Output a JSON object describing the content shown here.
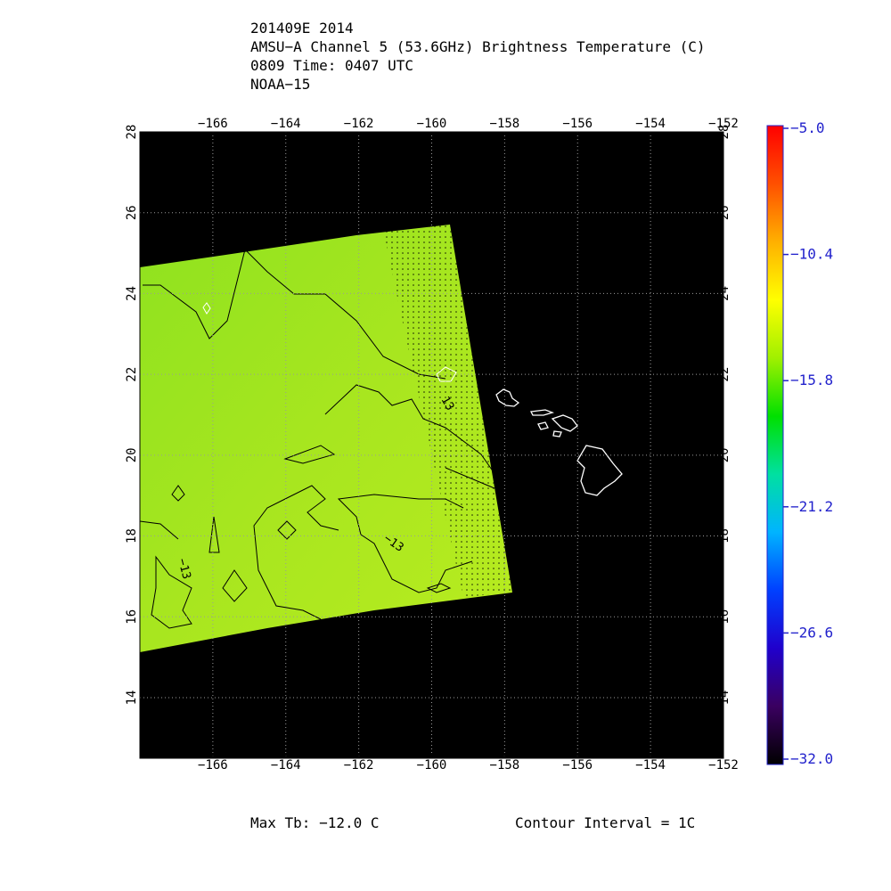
{
  "header": {
    "line1": "201409E 2014",
    "line2": "AMSU−A Channel 5 (53.6GHz) Brightness Temperature (C)",
    "line3": "0809 Time: 0407 UTC",
    "line4": "NOAA−15"
  },
  "map": {
    "lon_range": [
      -168,
      -152
    ],
    "lat_range": [
      12.5,
      28
    ],
    "lon_ticks": [
      "−166",
      "−164",
      "−162",
      "−160",
      "−158",
      "−156",
      "−154",
      "−152"
    ],
    "lon_tick_values": [
      -166,
      -164,
      -162,
      -160,
      -158,
      -156,
      -154,
      -152
    ],
    "lat_ticks": [
      "14",
      "16",
      "18",
      "20",
      "22",
      "24",
      "26",
      "28"
    ],
    "lat_tick_values": [
      14,
      16,
      18,
      20,
      22,
      24,
      26,
      28
    ],
    "grid": true,
    "background_color": "#000000",
    "data_color": "#a8e61f",
    "coastline_color": "#ffffff",
    "contour_label": "−13",
    "contour_labels_shown": [
      "−13",
      "−13",
      "13"
    ]
  },
  "colorbar": {
    "colors": [
      "#000000",
      "#3a0060",
      "#2000cc",
      "#0040ff",
      "#00b4ff",
      "#00e0a0",
      "#00e000",
      "#a0f000",
      "#ffff00",
      "#ffb000",
      "#ff5000",
      "#ff0000"
    ],
    "tick_labels": [
      "−5.0",
      "−10.4",
      "−15.8",
      "−21.2",
      "−26.6",
      "−32.0"
    ],
    "tick_values": [
      -5.0,
      -10.4,
      -15.8,
      -21.2,
      -26.6,
      -32.0
    ],
    "label_color": "#2222cc"
  },
  "footer": {
    "max_tb": "Max Tb: −12.0    C",
    "contour_interval": "Contour Interval = 1C"
  }
}
